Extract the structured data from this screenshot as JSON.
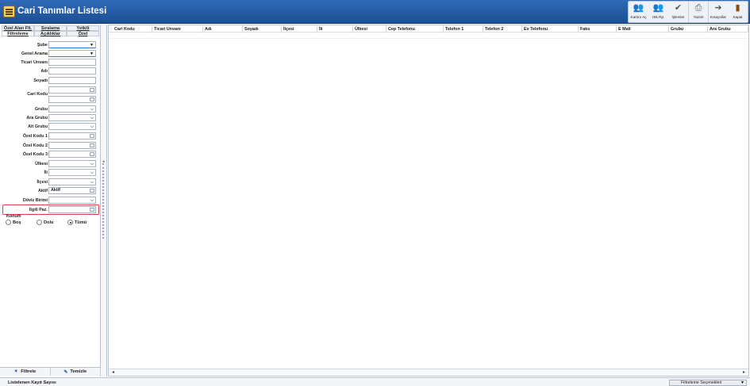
{
  "window": {
    "title": "Cari Tanımlar Listesi"
  },
  "toolbar": {
    "buttons": [
      {
        "label": "Kartını Aç",
        "icon": "people-icon"
      },
      {
        "label": "Hrk.Rp.",
        "icon": "report-icon"
      },
      {
        "label": "İşlemler",
        "icon": "checklist-icon"
      },
      {
        "label": "Yazdır",
        "icon": "printer-icon"
      },
      {
        "label": "Kısayollar",
        "icon": "shortcut-icon"
      },
      {
        "label": "Kapat",
        "icon": "door-icon"
      }
    ]
  },
  "left_panel": {
    "tabs_row1": [
      "Özel Alan Flt.",
      "Sıralama",
      "Yetkili"
    ],
    "tabs_row2": [
      "Filtreleme",
      "Açıklıklar",
      "Özel"
    ],
    "filters": {
      "sube": "Şube",
      "genel_arama": "Genel Arama",
      "ticari_unvani": "Ticari Unvanı",
      "adi": "Adı",
      "soyadi": "Soyadı",
      "cari_kodu": "Cari Kodu",
      "grubu": "Grubu",
      "ara_grubu": "Ara Grubu",
      "alt_grubu": "Alt Grubu",
      "ozel_kodu_1": "Özel Kodu 1",
      "ozel_kodu_2": "Özel Kodu 2",
      "ozel_kodu_3": "Özel Kodu 3",
      "ulkesi": "Ülkesi",
      "ili": "İli",
      "ilcesi": "İlçesi",
      "aktif": "Aktif",
      "aktif_value": "Aktif",
      "doviz_birimi": "Döviz Birimi",
      "ilgili_paz": "İlgili Paz."
    },
    "konum": {
      "label": "Konum",
      "options": [
        "Boş",
        "Dolu",
        "Tümü"
      ],
      "selected": "Tümü"
    },
    "buttons": {
      "filtrele": "Filtrele",
      "temizle": "Temizle"
    }
  },
  "grid": {
    "columns": [
      "Cari Kodu",
      "Ticari Unvanı",
      "Adı",
      "Soyadı",
      "İlçesi",
      "İli",
      "Ülkesi",
      "Cep Telefonu",
      "Telefon 1",
      "Telefon 2",
      "Ev Telefonu",
      "Faks",
      "E Mail",
      "Grubu",
      "Ara Grubu"
    ]
  },
  "status_bar": {
    "record_count_label": "Listelenen Kayıt Sayısı",
    "filter_options": "Filtreleme Seçenekleri"
  }
}
